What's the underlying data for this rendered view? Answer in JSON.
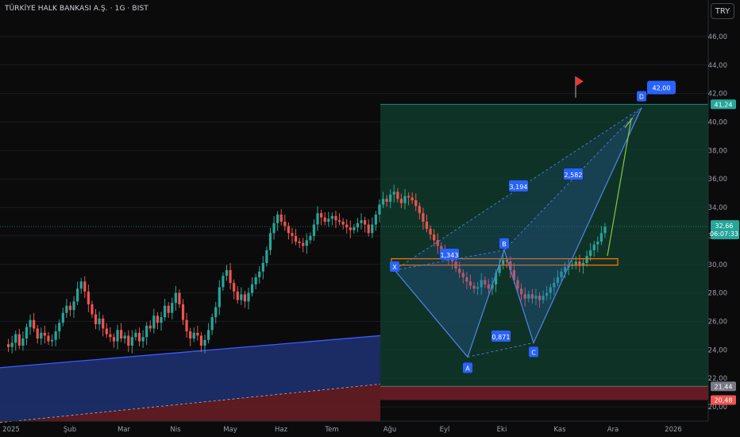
{
  "header": {
    "title": "TÜRKİYE HALK BANKASI A.Ş. · 1G · BIST",
    "currency_button": "TRY"
  },
  "colors": {
    "up": "#26a69a",
    "down": "#ef5350",
    "channel_line": "#3b5bff",
    "channel_fill": "#1d2f6e",
    "red_zone": "#6b1d26",
    "green_zone": "#0f3b2c",
    "harmonic_fill": "#2d5fb5",
    "harmonic_line": "#4f7fd9",
    "label_bg": "#2962ff",
    "orange_box": "#ff6d00",
    "projection": "#8bc34a",
    "flag": "#e53935"
  },
  "chart_data": {
    "type": "candlestick",
    "symbol": "HALKB",
    "exchange": "BIST",
    "interval": "1G",
    "currency": "TRY",
    "ylim": [
      19,
      47
    ],
    "y_ticks": [
      "20,00",
      "22,00",
      "24,00",
      "26,00",
      "28,00",
      "30,00",
      "32,00",
      "34,00",
      "36,00",
      "38,00",
      "40,00",
      "42,00",
      "44,00",
      "46,00"
    ],
    "x_ticks": [
      "2025",
      "Şub",
      "Mar",
      "Nis",
      "May",
      "Haz",
      "Tem",
      "Ağu",
      "Eyl",
      "Eki",
      "Kas",
      "Ara",
      "2026"
    ],
    "ohlc_path": [
      24.4,
      24.2,
      24.5,
      25.1,
      24.3,
      24.8,
      25.6,
      26.1,
      25.5,
      24.8,
      25.2,
      25.0,
      24.6,
      24.7,
      25.3,
      25.9,
      26.6,
      27.1,
      26.8,
      27.4,
      28.3,
      28.8,
      28.1,
      27.2,
      26.5,
      25.8,
      26.2,
      25.5,
      25.1,
      24.9,
      24.6,
      25.4,
      24.8,
      25.0,
      24.3,
      24.9,
      25.2,
      24.6,
      24.9,
      25.7,
      25.5,
      26.4,
      25.9,
      26.3,
      27.1,
      26.6,
      27.3,
      28.0,
      27.2,
      26.1,
      25.3,
      24.8,
      25.2,
      25.0,
      24.3,
      24.7,
      25.4,
      26.3,
      27.0,
      28.4,
      29.2,
      29.6,
      28.7,
      28.1,
      27.5,
      27.9,
      27.4,
      28.0,
      28.6,
      29.1,
      29.5,
      30.1,
      31.0,
      32.2,
      32.9,
      33.5,
      33.0,
      32.7,
      32.2,
      32.0,
      31.6,
      31.5,
      31.3,
      31.7,
      32.0,
      32.8,
      33.6,
      33.3,
      33.0,
      33.2,
      33.4,
      33.1,
      33.0,
      32.8,
      32.6,
      32.4,
      32.6,
      32.9,
      33.1,
      32.8,
      32.2,
      32.8,
      33.5,
      34.2,
      34.6,
      34.4,
      34.9,
      35.1,
      34.6,
      34.3,
      34.8,
      34.7,
      34.5,
      34.1,
      33.6,
      33.0,
      32.5,
      32.1,
      31.7,
      31.3,
      31.0,
      30.6,
      30.4,
      30.2,
      29.7,
      29.4,
      29.1,
      28.8,
      28.5,
      28.3,
      28.4,
      28.9,
      28.6,
      28.3,
      28.6,
      29.4,
      30.0,
      30.3,
      30.2,
      29.6,
      28.9,
      28.3,
      27.9,
      27.6,
      27.9,
      27.6,
      27.8,
      27.5,
      27.8,
      28.0,
      28.4,
      28.7,
      29.1,
      29.5,
      29.8,
      29.9,
      30.0,
      30.2,
      29.9,
      30.1,
      30.6,
      31.0,
      31.4,
      31.6,
      32.2,
      32.66
    ],
    "last_price": "32,66",
    "countdown": "06:07:33",
    "levels": [
      {
        "label": "41,24",
        "value": 41.24,
        "color": "#26a69a"
      },
      {
        "label": "21,44",
        "value": 21.44,
        "color": "#787b86"
      },
      {
        "label": "20,48",
        "value": 20.48,
        "color": "#ef5350"
      }
    ],
    "harmonic_pattern": {
      "points": [
        {
          "label": "X",
          "value": 29.6
        },
        {
          "label": "A",
          "value": 23.5
        },
        {
          "label": "B",
          "value": 31.0
        },
        {
          "label": "C",
          "value": 24.5
        },
        {
          "label": "D",
          "value": 41.0
        }
      ],
      "ratios": [
        "1,343",
        "0,871",
        "3,194",
        "2,582"
      ]
    },
    "target_label": "42,00",
    "target_value": 42.0,
    "resistance_zone": [
      29.95,
      30.4
    ]
  }
}
